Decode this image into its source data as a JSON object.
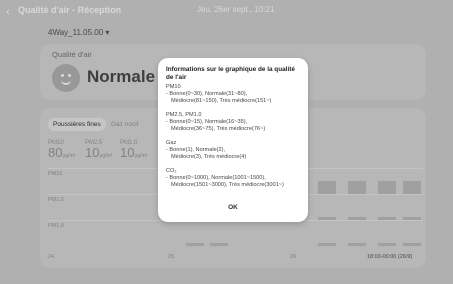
{
  "header": {
    "title": "Qualité d'air - Réception",
    "datetime": "Jeu. 26er sept., 10:21"
  },
  "device": {
    "name": "4Way_11.05.00"
  },
  "air_quality": {
    "label": "Qualité d'air",
    "status": "Normale"
  },
  "tabs": [
    {
      "label": "Poussières fines"
    },
    {
      "label": "Gaz nocif"
    }
  ],
  "metrics": [
    {
      "name": "PM10",
      "value": "80",
      "unit": "μg/m³"
    },
    {
      "name": "PM2.5",
      "value": "10",
      "unit": "μg/m³"
    },
    {
      "name": "PM1.0",
      "value": "10",
      "unit": "μg/m³"
    }
  ],
  "chart": {
    "rows": [
      "PM10",
      "PM2.5",
      "PM1.0"
    ],
    "x_ticks": [
      "24",
      "25",
      "26"
    ],
    "range_label": "18:00-00:00 (26/9)"
  },
  "dialog": {
    "title": "Informations sur le graphique de la qualité de l'air",
    "sections": [
      {
        "name": "PM10",
        "lines": [
          "- Bonne(0~30), Normale(31~80),",
          "Médiocre(81~150), Très médiocre(151~)"
        ]
      },
      {
        "name": "PM2.5, PM1.0",
        "lines": [
          "- Bonne(0~15), Normale(16~35),",
          "Médiocre(36~75), Très médiocre(76~)"
        ]
      },
      {
        "name": "Gaz",
        "lines": [
          "- Bonne(1), Normale(2),",
          "Médiocre(3), Très médiocre(4)"
        ]
      },
      {
        "name": "CO₂",
        "lines": [
          "- Bonne(0~1000), Normale(1001~1500),",
          "Médiocre(1501~3000), Très médiocre(3001~)"
        ]
      }
    ],
    "ok_label": "OK"
  },
  "colors": {
    "background": "#cfcfcf",
    "card": "#d7d7d7",
    "bar": "#bcbcbc",
    "dialog": "#ffffff"
  }
}
